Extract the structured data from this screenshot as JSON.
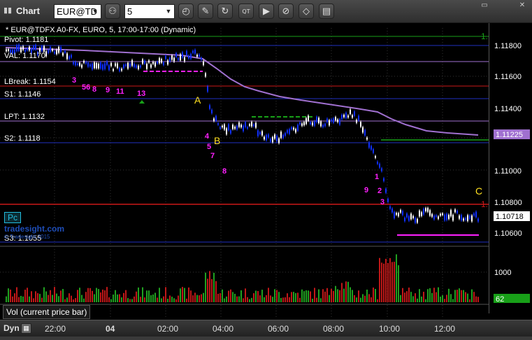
{
  "app": {
    "title": "Chart"
  },
  "toolbar": {
    "symbol_value": "EUR@TD",
    "interval_value": "5",
    "icons": [
      "link-icon",
      "gear-icon",
      "clock-icon",
      "pencil-icon",
      "refresh-icon",
      "quote-icon",
      "play-icon",
      "no-icon",
      "tag-icon",
      "layers-icon"
    ]
  },
  "header": {
    "instrument": "* EUR@TDFX A0-FX, EURO, 5, 17:00-17:00 (Dynamic)"
  },
  "levels": {
    "pivot": "Pivot: 1.1181",
    "val": "VAL: 1.1170",
    "lbreak": "LBreak: 1.1154",
    "s1": "S1: 1.1146",
    "lpt": "LPT: 1.1132",
    "s2": "S2: 1.1118",
    "s3": "S3: 1.1055"
  },
  "price_axis": {
    "ticks": [
      "1.11800",
      "1.11600",
      "1.11400",
      "1.11000",
      "1.10800",
      "1.10600"
    ],
    "highlight_ma": "1.11225",
    "highlight_last": "1.10718"
  },
  "annotations": {
    "A": "A",
    "B": "B",
    "C": "C",
    "label_1_right": "1.",
    "label_1_top": "1.",
    "td_marks": [
      "3",
      "56",
      "8",
      "9",
      "11",
      "13",
      "8",
      "9",
      "1",
      "2",
      "3",
      "4",
      "5",
      "7"
    ]
  },
  "volume": {
    "label": "Vol (current price bar)",
    "axis_tick": "1000",
    "current": "62"
  },
  "watermark": {
    "brand": "tradesight.com",
    "sub": "© Tradesight 2015"
  },
  "badge": "Pc",
  "time_axis": {
    "mode": "Dyn",
    "ticks": [
      "22:00",
      "04",
      "02:00",
      "04:00",
      "06:00",
      "08:00",
      "10:00",
      "12:00"
    ]
  },
  "colors": {
    "bull": "#ffffff",
    "bear": "#1030ff",
    "ma": "#a070d0",
    "pivot": "#18a018",
    "support": "#2030c0",
    "resistance": "#cc1818",
    "vol_up": "#20a020",
    "vol_down": "#c01818",
    "td_magenta": "#ff20ff",
    "td_green": "#20a030",
    "annot": "#ffe020"
  }
}
